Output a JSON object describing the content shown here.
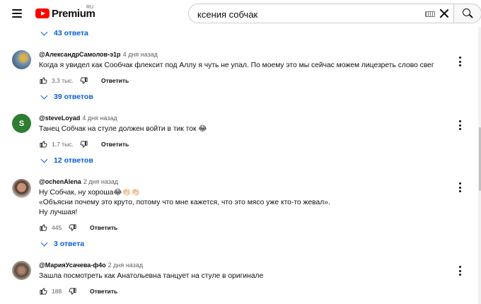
{
  "header": {
    "logo_text": "Premium",
    "logo_region": "RU",
    "search_value": "ксения собчак"
  },
  "thread0": {
    "replies_label": "43 ответа"
  },
  "comments": [
    {
      "author": "@АлександрСамолов-э1р",
      "time": "4 дня назад",
      "lines": [
        "Когда я увидел как Сообчак флексит под Аллу я чуть не упал. По моему это мы сейчас можем лицезреть слово свег"
      ],
      "likes": "3,3 тыс.",
      "reply_label": "Ответить",
      "replies_label": "39 ответов",
      "avatar_letter": ""
    },
    {
      "author": "@steveLoyad",
      "time": "4 дня назад",
      "lines": [
        "Танец Собчак на стуле должен войти в тик ток 😂"
      ],
      "likes": "1,7 тыс.",
      "reply_label": "Ответить",
      "replies_label": "12 ответов",
      "avatar_letter": "S"
    },
    {
      "author": "@ochenAlena",
      "time": "2 дня назад",
      "lines": [
        "Ну Собчак, ну хороша😂👏🏻👏🏻",
        "«Объясни почему это круто, потому что мне кажется, что это мясо уже кто-то жевал».",
        "Ну лучшая!"
      ],
      "likes": "445",
      "reply_label": "Ответить",
      "replies_label": "3 ответа",
      "avatar_letter": ""
    },
    {
      "author": "@МарияУсачева-ф4о",
      "time": "2 дня назад",
      "lines": [
        "Зашла посмотреть как Анатольевна танцует на стуле в оригинале"
      ],
      "likes": "188",
      "reply_label": "Ответить",
      "avatar_letter": ""
    }
  ],
  "colors": {
    "accent_link": "#065fd4",
    "brand_red": "#ff0000",
    "avatar_s": "#2e7d32"
  },
  "icons": [
    "menu-icon",
    "youtube-logo-icon",
    "keyboard-icon",
    "clear-icon",
    "search-icon",
    "like-icon",
    "dislike-icon",
    "more-vert-icon",
    "chevron-down-icon"
  ]
}
